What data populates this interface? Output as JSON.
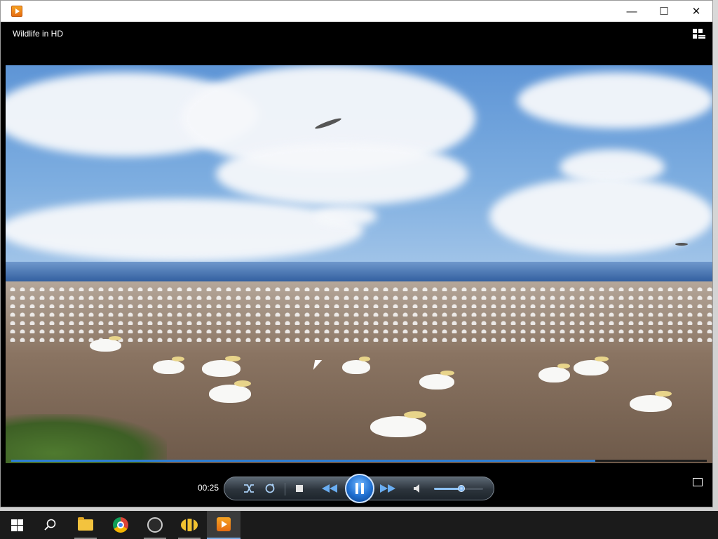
{
  "window": {
    "minimize_glyph": "—",
    "maximize_glyph": "☐",
    "close_glyph": "✕"
  },
  "player": {
    "now_playing_title": "Wildlife in HD",
    "elapsed_time": "00:25",
    "seek_progress": 0.84,
    "volume_level": 0.55,
    "state": "playing",
    "accent_color": "#2e7fd3",
    "controls": {
      "shuffle_icon": "shuffle-icon",
      "repeat_icon": "repeat-icon",
      "stop_icon": "stop-icon",
      "previous_icon": "rewind-icon",
      "pause_icon": "pause-icon",
      "next_icon": "fast-forward-icon",
      "mute_icon": "speaker-icon",
      "switch_view_icon": "switch-to-library-icon",
      "playlist_icon": "playlist-toggle-icon"
    }
  },
  "taskbar": {
    "items": [
      {
        "name": "start",
        "icon": "windows-logo-icon"
      },
      {
        "name": "search",
        "icon": "search-icon"
      },
      {
        "name": "file-explorer",
        "icon": "folder-icon"
      },
      {
        "name": "chrome",
        "icon": "chrome-icon"
      },
      {
        "name": "obs",
        "icon": "obs-icon"
      },
      {
        "name": "app",
        "icon": "bee-icon"
      },
      {
        "name": "media-player",
        "icon": "media-player-icon",
        "active": true
      }
    ]
  }
}
